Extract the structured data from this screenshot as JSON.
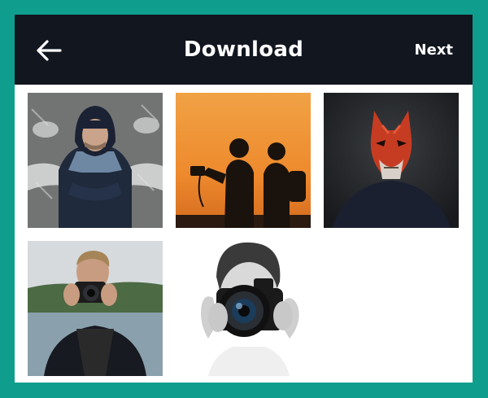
{
  "header": {
    "title": "Download",
    "next_label": "Next",
    "back_icon": "arrow-left-icon",
    "background": "#12161f"
  },
  "page": {
    "border_color": "#0f9e8e",
    "background": "#ffffff"
  },
  "photos": [
    {
      "subject": "man-in-hoodie-chalkboard"
    },
    {
      "subject": "two-silhouettes-sunset"
    },
    {
      "subject": "man-in-red-fox-mask"
    },
    {
      "subject": "man-holding-camera-lake"
    },
    {
      "subject": "person-holding-camera-bw"
    }
  ]
}
